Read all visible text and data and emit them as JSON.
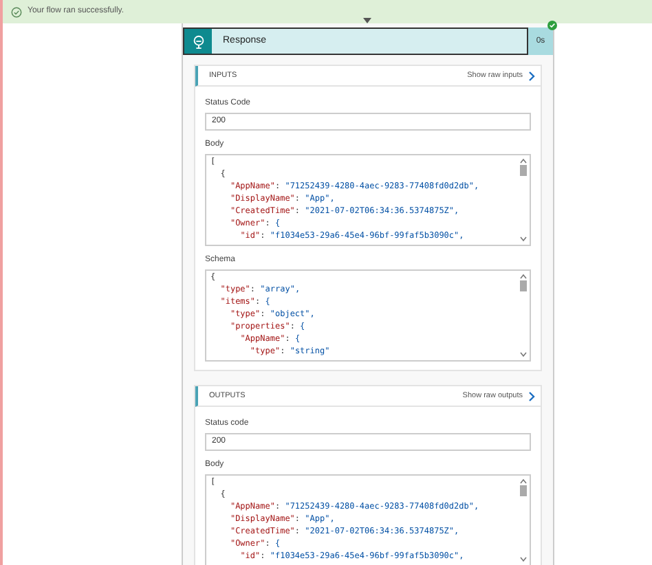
{
  "banner": {
    "text": "Your flow ran successfully."
  },
  "action": {
    "title": "Response",
    "duration": "0s",
    "succeeded": true
  },
  "sections": [
    {
      "heading": "INPUTS",
      "raw_link": "Show raw inputs",
      "fields": [
        {
          "kind": "text",
          "label": "Status Code",
          "value": "200"
        },
        {
          "kind": "code",
          "label": "Body",
          "lines": [
            "[",
            "  {",
            "    \"AppName\": \"71252439-4280-4aec-9283-77408fd0d2db\",",
            "    \"DisplayName\": \"App\",",
            "    \"CreatedTime\": \"2021-07-02T06:34:36.5374875Z\",",
            "    \"Owner\": {",
            "      \"id\": \"f1034e53-29a6-45e4-96bf-99faf5b3090c\","
          ]
        },
        {
          "kind": "code",
          "label": "Schema",
          "lines": [
            "{",
            "  \"type\": \"array\",",
            "  \"items\": {",
            "    \"type\": \"object\",",
            "    \"properties\": {",
            "      \"AppName\": {",
            "        \"type\": \"string\""
          ]
        }
      ]
    },
    {
      "heading": "OUTPUTS",
      "raw_link": "Show raw outputs",
      "fields": [
        {
          "kind": "text",
          "label": "Status code",
          "value": "200"
        },
        {
          "kind": "code",
          "label": "Body",
          "lines": [
            "[",
            "  {",
            "    \"AppName\": \"71252439-4280-4aec-9283-77408fd0d2db\",",
            "    \"DisplayName\": \"App\",",
            "    \"CreatedTime\": \"2021-07-02T06:34:36.5374875Z\",",
            "    \"Owner\": {",
            "      \"id\": \"f1034e53-29a6-45e4-96bf-99faf5b3090c\","
          ]
        }
      ]
    }
  ]
}
